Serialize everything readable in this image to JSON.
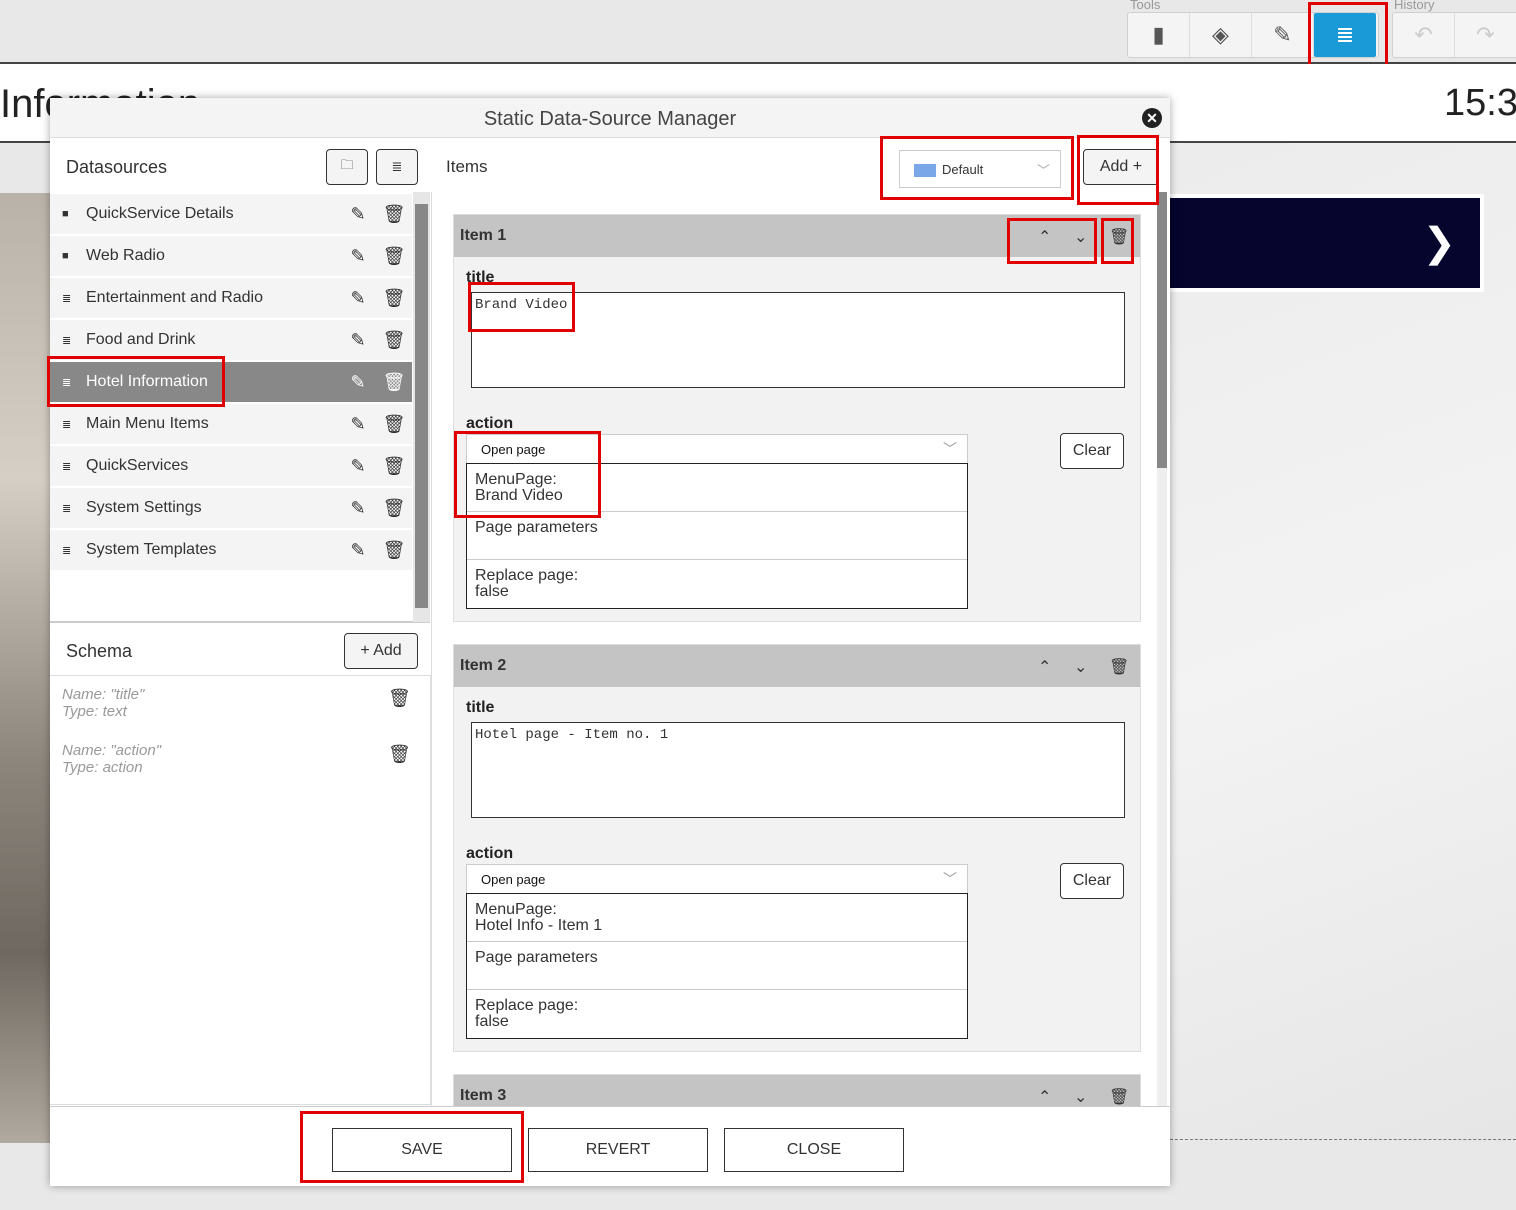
{
  "toolbar": {
    "tools_label": "Tools",
    "history_label": "History",
    "tools": [
      {
        "icon": "remote-icon",
        "glyph": "▮"
      },
      {
        "icon": "layers-icon",
        "glyph": "◈"
      },
      {
        "icon": "magic-wand-icon",
        "glyph": "✎"
      },
      {
        "icon": "database-icon",
        "glyph": "≣",
        "active": true
      }
    ],
    "history": [
      {
        "icon": "undo-icon",
        "glyph": "↶"
      },
      {
        "icon": "redo-icon",
        "glyph": "↷"
      }
    ],
    "accent": "#1a9ad6"
  },
  "page": {
    "title": "Information",
    "clock": "15:3",
    "arrow": "❯"
  },
  "modal": {
    "title": "Static Data-Source Manager",
    "close": "✕",
    "datasources": {
      "heading": "Datasources",
      "items": [
        {
          "label": "QuickService Details",
          "type": "folder"
        },
        {
          "label": "Web Radio",
          "type": "folder"
        },
        {
          "label": "Entertainment and Radio",
          "type": "database"
        },
        {
          "label": "Food and Drink",
          "type": "database"
        },
        {
          "label": "Hotel Information",
          "type": "database",
          "selected": true
        },
        {
          "label": "Main Menu Items",
          "type": "database"
        },
        {
          "label": "QuickServices",
          "type": "database"
        },
        {
          "label": "System Settings",
          "type": "database"
        },
        {
          "label": "System Templates",
          "type": "database"
        }
      ]
    },
    "schema": {
      "heading": "Schema",
      "add_label": "+ Add",
      "fields": [
        {
          "name": "Name: \"title\"",
          "type": "Type: text"
        },
        {
          "name": "Name: \"action\"",
          "type": "Type: action"
        }
      ]
    },
    "items_panel": {
      "heading": "Items",
      "language": "Default",
      "add_label": "Add +",
      "items": [
        {
          "header": "Item 1",
          "title_label": "title",
          "title_value": "Brand Video",
          "action_label": "action",
          "action_value": "Open page",
          "options": [
            "MenuPage:\nBrand Video",
            "Page parameters",
            "Replace page:\nfalse"
          ],
          "clear_label": "Clear"
        },
        {
          "header": "Item 2",
          "title_label": "title",
          "title_value": "Hotel page - Item no. 1",
          "action_label": "action",
          "action_value": "Open page",
          "options": [
            "MenuPage:\nHotel Info - Item 1",
            "Page parameters",
            "Replace page:\nfalse"
          ],
          "clear_label": "Clear"
        },
        {
          "header": "Item 3"
        }
      ]
    },
    "footer": {
      "save": "SAVE",
      "revert": "REVERT",
      "close": "CLOSE"
    }
  }
}
